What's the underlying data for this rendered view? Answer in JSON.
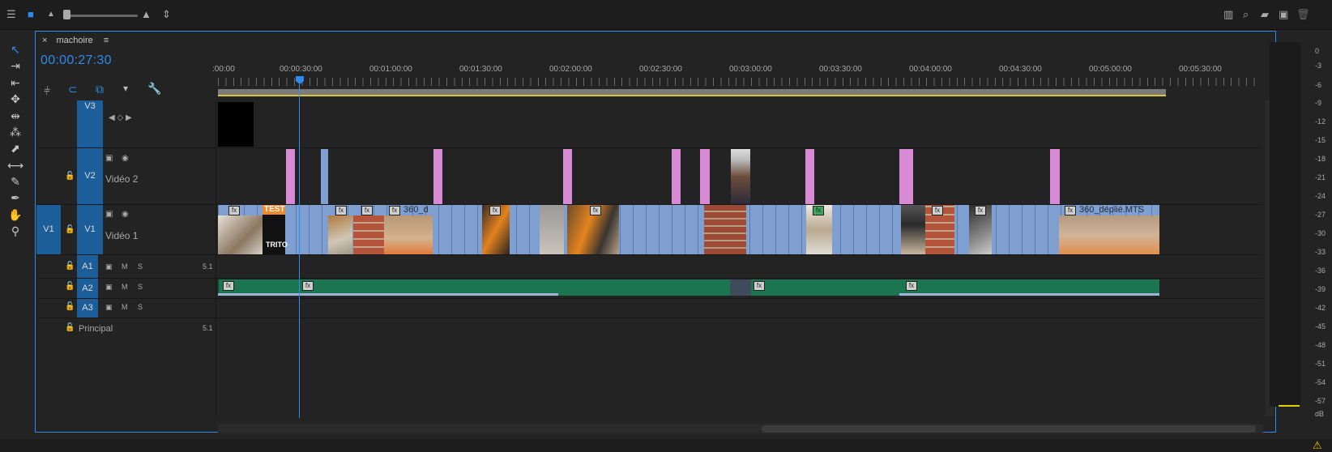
{
  "panel": {
    "title": "machoire",
    "timecode": "00:00:27:30"
  },
  "ruler": {
    "labels": [
      ":00:00",
      "00:00:30:00",
      "00:01:00:00",
      "00:01:30:00",
      "00:02:00:00",
      "00:02:30:00",
      "00:03:00:00",
      "00:03:30:00",
      "00:04:00:00",
      "00:04:30:00",
      "00:05:00:00",
      "00:05:30:00"
    ]
  },
  "tracks": {
    "v3": {
      "label": "V3"
    },
    "v2": {
      "label": "V2",
      "name": "Vidéo 2"
    },
    "v1": {
      "source": "V1",
      "label": "V1",
      "name": "Vidéo 1"
    },
    "a1": {
      "label": "A1",
      "m": "M",
      "s": "S",
      "channels": "5.1"
    },
    "a2": {
      "label": "A2",
      "m": "M",
      "s": "S"
    },
    "a3": {
      "label": "A3",
      "m": "M",
      "s": "S"
    },
    "master": {
      "name": "Principal",
      "channels": "5.1"
    }
  },
  "clips": {
    "test": "TEST",
    "trito": "TRITO",
    "c360a": "360_d",
    "c360b": "360_déplié.MTS",
    "fx": "fx"
  },
  "meter": {
    "labels": [
      "0",
      "-3",
      "-6",
      "-9",
      "-12",
      "-15",
      "-18",
      "-21",
      "-24",
      "-27",
      "-30",
      "-33",
      "-36",
      "-39",
      "-42",
      "-45",
      "-48",
      "-51",
      "-54",
      "-57",
      "dB"
    ]
  },
  "icons": [
    "list-icon",
    "monitor-icon",
    "zoom-out-icon",
    "zoom-in-icon",
    "updown-icon",
    "selection-tool-icon",
    "track-select-icon",
    "ripple-edit-icon",
    "rolling-edit-icon",
    "rate-stretch-icon",
    "razor-icon",
    "slip-icon",
    "slide-icon",
    "pen-icon",
    "hand-icon",
    "zoom-tool-icon",
    "warning-icon"
  ],
  "colors": {
    "accent": "#2d8ceb",
    "video_clip": "#7f9fd1",
    "audio_clip": "#1a7550",
    "adjustment_clip": "#d98ad4"
  }
}
